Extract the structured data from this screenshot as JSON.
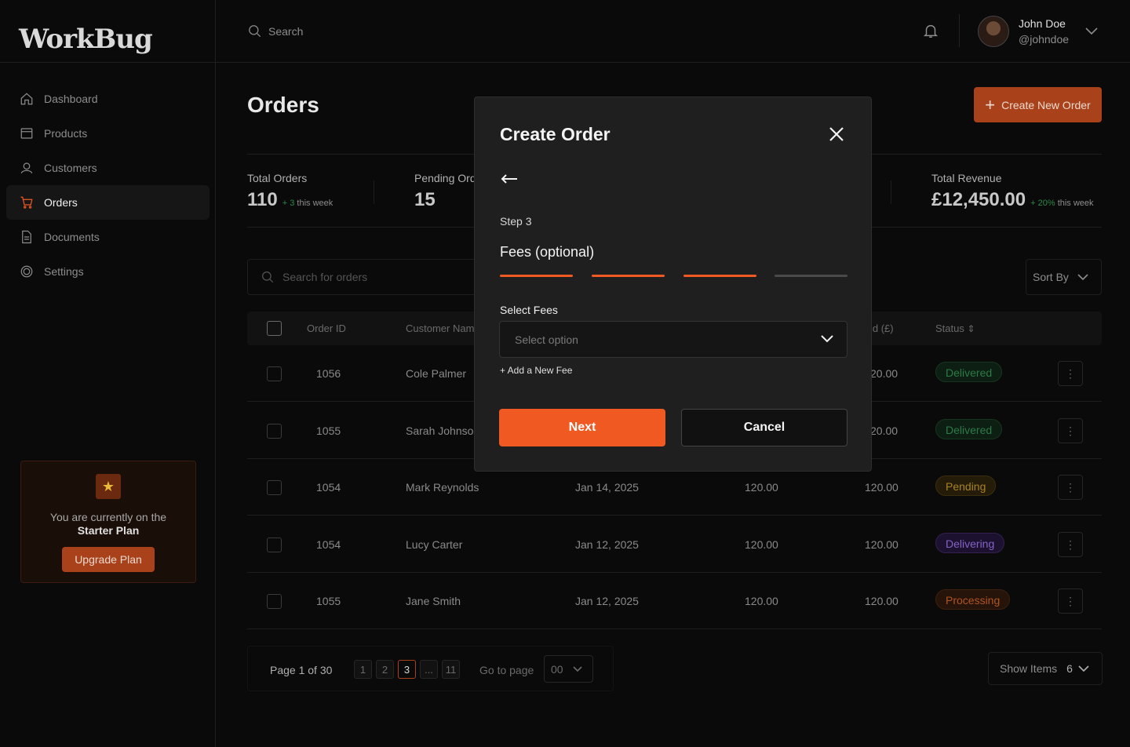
{
  "app": {
    "logo": "WorkBug"
  },
  "sidebar": {
    "items": [
      {
        "label": "Dashboard",
        "icon": "home-icon"
      },
      {
        "label": "Products",
        "icon": "box-icon"
      },
      {
        "label": "Customers",
        "icon": "user-icon"
      },
      {
        "label": "Orders",
        "icon": "cart-icon",
        "active": true
      },
      {
        "label": "Documents",
        "icon": "document-icon"
      },
      {
        "label": "Settings",
        "icon": "settings-icon"
      }
    ],
    "plan": {
      "text": "You are currently on the",
      "name": "Starter Plan",
      "button": "Upgrade Plan"
    }
  },
  "header": {
    "search_placeholder": "Search",
    "user": {
      "name": "John Doe",
      "handle": "@johndoe"
    }
  },
  "main": {
    "title": "Orders",
    "create_button": "Create New Order",
    "stats": [
      {
        "label": "Total Orders",
        "value": "110",
        "delta": "+ 3",
        "delta_suffix": "this week"
      },
      {
        "label": "Pending Ord",
        "value": "15"
      },
      {
        "label": "Total Revenue",
        "value": "£12,450.00",
        "delta": "+ 20%",
        "delta_suffix": "this week"
      }
    ],
    "search_placeholder": "Search for orders",
    "sort_label": "Sort By",
    "table": {
      "headers": {
        "order_id": "Order ID",
        "customer": "Customer Name",
        "paid": "id (£)",
        "status": "Status"
      },
      "rows": [
        {
          "id": "1056",
          "customer": "Cole Palmer",
          "date": "",
          "amount": "",
          "paid": "20.00",
          "status": "Delivered"
        },
        {
          "id": "1055",
          "customer": "Sarah Johnson",
          "date": "",
          "amount": "",
          "paid": "20.00",
          "status": "Delivered"
        },
        {
          "id": "1054",
          "customer": "Mark Reynolds",
          "date": "Jan 14, 2025",
          "amount": "120.00",
          "paid": "120.00",
          "status": "Pending"
        },
        {
          "id": "1054",
          "customer": "Lucy Carter",
          "date": "Jan 12, 2025",
          "amount": "120.00",
          "paid": "120.00",
          "status": "Delivering"
        },
        {
          "id": "1055",
          "customer": "Jane Smith",
          "date": "Jan 12, 2025",
          "amount": "120.00",
          "paid": "120.00",
          "status": "Processing"
        }
      ]
    },
    "pagination": {
      "info": "Page 1 of 30",
      "pages": [
        "1",
        "2",
        "3",
        "...",
        "11"
      ],
      "current": "3",
      "goto_label": "Go to page",
      "goto_value": "00"
    },
    "show_items": {
      "label": "Show Items",
      "value": "6"
    }
  },
  "modal": {
    "title": "Create Order",
    "step": "Step 3",
    "step_title": "Fees (optional)",
    "progress": {
      "completed": 3,
      "total": 4
    },
    "fees_label": "Select Fees",
    "fees_placeholder": "Select option",
    "add_fee": "+ Add a New Fee",
    "next": "Next",
    "cancel": "Cancel"
  },
  "colors": {
    "accent": "#f05a22",
    "accent_dark": "#a9421a",
    "background": "#0a0a0a",
    "modal_bg": "#1f1f1f"
  }
}
